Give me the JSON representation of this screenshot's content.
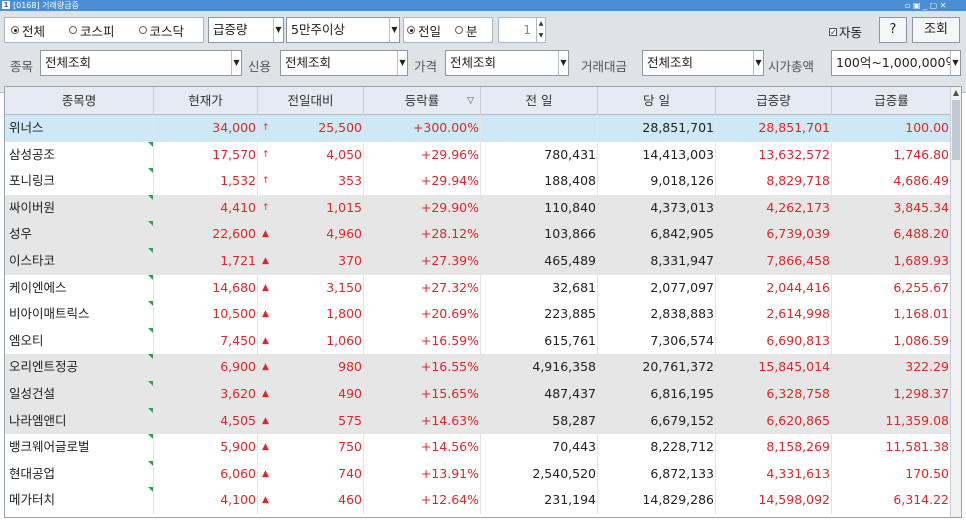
{
  "window": {
    "title": "[0168] 거래량급증",
    "icon": "1",
    "controls": "▫ ▣ _ ▢ ✕"
  },
  "market_radios": [
    {
      "label": "전체",
      "selected": true
    },
    {
      "label": "코스피",
      "selected": false
    },
    {
      "label": "코스닥",
      "selected": false
    }
  ],
  "sort_select": "급증량",
  "volume_select": "5만주이상",
  "period_radios": [
    {
      "label": "전일",
      "selected": true
    },
    {
      "label": "분",
      "selected": false
    }
  ],
  "minute_value": "1",
  "auto_label": "자동",
  "help_button": "?",
  "query_button": "조회",
  "filters": {
    "stock_label": "종목",
    "stock_value": "전체조회",
    "credit_label": "신용",
    "credit_value": "전체조회",
    "price_label": "가격",
    "price_value": "전체조회",
    "amount_label": "거래대금",
    "amount_value": "전체조회",
    "cap_label": "시가총액",
    "cap_value": "100억~1,000,000억"
  },
  "table": {
    "headers": [
      "종목명",
      "현재가",
      "전일대비",
      "등락률",
      "전 일",
      "당 일",
      "급증량",
      "급증률"
    ],
    "rows": [
      [
        "위너스",
        "34,000",
        "↑",
        "25,500",
        "+300.00%",
        "",
        "28,851,701",
        "28,851,701",
        "100.00"
      ],
      [
        "삼성공조",
        "17,570",
        "↑",
        "4,050",
        "+29.96%",
        "780,431",
        "14,413,003",
        "13,632,572",
        "1,746.80"
      ],
      [
        "포니링크",
        "1,532",
        "↑",
        "353",
        "+29.94%",
        "188,408",
        "9,018,126",
        "8,829,718",
        "4,686.49"
      ],
      [
        "싸이버원",
        "4,410",
        "↑",
        "1,015",
        "+29.90%",
        "110,840",
        "4,373,013",
        "4,262,173",
        "3,845.34"
      ],
      [
        "성우",
        "22,600",
        "▲",
        "4,960",
        "+28.12%",
        "103,866",
        "6,842,905",
        "6,739,039",
        "6,488.20"
      ],
      [
        "이스타코",
        "1,721",
        "▲",
        "370",
        "+27.39%",
        "465,489",
        "8,331,947",
        "7,866,458",
        "1,689.93"
      ],
      [
        "케이엔에스",
        "14,680",
        "▲",
        "3,150",
        "+27.32%",
        "32,681",
        "2,077,097",
        "2,044,416",
        "6,255.67"
      ],
      [
        "비아이매트릭스",
        "10,500",
        "▲",
        "1,800",
        "+20.69%",
        "223,885",
        "2,838,883",
        "2,614,998",
        "1,168.01"
      ],
      [
        "엠오티",
        "7,450",
        "▲",
        "1,060",
        "+16.59%",
        "615,761",
        "7,306,574",
        "6,690,813",
        "1,086.59"
      ],
      [
        "오리엔트정공",
        "6,900",
        "▲",
        "980",
        "+16.55%",
        "4,916,358",
        "20,761,372",
        "15,845,014",
        "322.29"
      ],
      [
        "일성건설",
        "3,620",
        "▲",
        "490",
        "+15.65%",
        "487,437",
        "6,816,195",
        "6,328,758",
        "1,298.37"
      ],
      [
        "나라엠앤디",
        "4,505",
        "▲",
        "575",
        "+14.63%",
        "58,287",
        "6,679,152",
        "6,620,865",
        "11,359.08"
      ],
      [
        "뱅크웨어글로벌",
        "5,900",
        "▲",
        "750",
        "+14.56%",
        "70,443",
        "8,228,712",
        "8,158,269",
        "11,581.38"
      ],
      [
        "현대공업",
        "6,060",
        "▲",
        "740",
        "+13.91%",
        "2,540,520",
        "6,872,133",
        "4,331,613",
        "170.50"
      ],
      [
        "메가터치",
        "4,100",
        "▲",
        "460",
        "+12.64%",
        "231,194",
        "14,829,286",
        "14,598,092",
        "6,314.22"
      ]
    ]
  },
  "colors": {
    "up": "#e0262a",
    "selected_row": "#cfe8f5",
    "shaded_row": "#e6e6e6",
    "header": "#e6ebf3"
  }
}
